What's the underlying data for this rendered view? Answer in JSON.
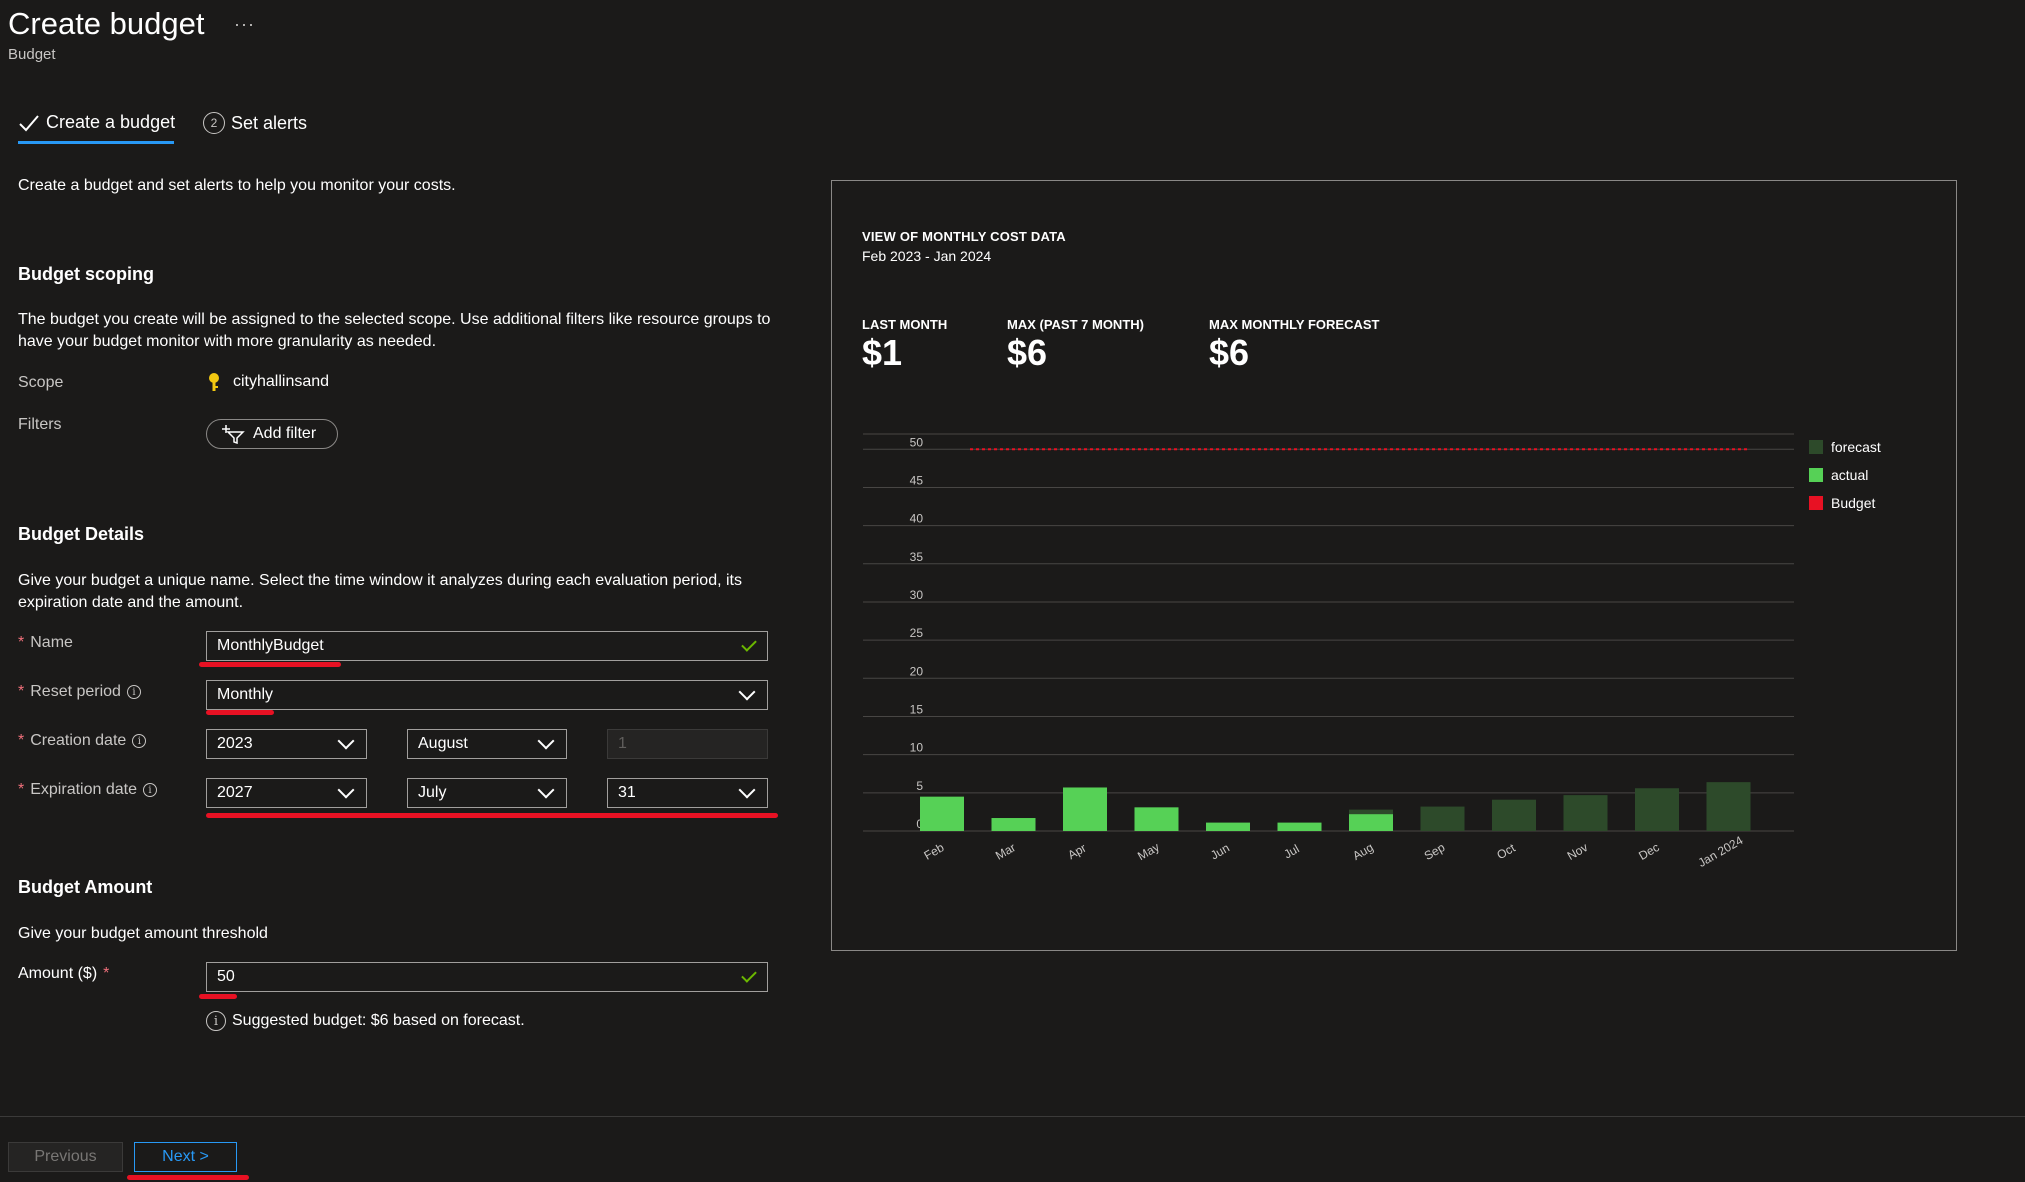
{
  "header": {
    "title": "Create budget",
    "more": "···",
    "subtitle": "Budget"
  },
  "tabs": [
    {
      "label": "Create a budget",
      "active": true
    },
    {
      "label": "Set alerts",
      "step": "2",
      "active": false
    }
  ],
  "intro": "Create a budget and set alerts to help you monitor your costs.",
  "scoping": {
    "heading": "Budget scoping",
    "description": "The budget you create will be assigned to the selected scope. Use additional filters like resource groups to have your budget monitor with more granularity as needed.",
    "scope_label": "Scope",
    "scope_value": "cityhallinsand",
    "filters_label": "Filters",
    "add_filter_label": "Add filter"
  },
  "details": {
    "heading": "Budget Details",
    "description": "Give your budget a unique name. Select the time window it analyzes during each evaluation period, its expiration date and the amount.",
    "required_mark": "*",
    "name_label": "Name",
    "name_value": "MonthlyBudget",
    "reset_label": "Reset period",
    "reset_value": "Monthly",
    "creation_label": "Creation date",
    "creation_year": "2023",
    "creation_month": "August",
    "creation_day": "1",
    "expiration_label": "Expiration date",
    "expiration_year": "2027",
    "expiration_month": "July",
    "expiration_day": "31"
  },
  "amount": {
    "heading": "Budget Amount",
    "description": "Give your budget amount threshold",
    "label": "Amount ($)",
    "value": "50",
    "suggestion": "Suggested budget: $6 based on forecast."
  },
  "footer": {
    "previous_label": "Previous",
    "next_label": "Next >"
  },
  "panel": {
    "title": "VIEW OF MONTHLY COST DATA",
    "range": "Feb 2023 - Jan 2024",
    "kpis": [
      {
        "label": "LAST MONTH",
        "value": "$1"
      },
      {
        "label": "MAX (PAST 7 MONTH)",
        "value": "$6"
      },
      {
        "label": "MAX MONTHLY FORECAST",
        "value": "$6"
      }
    ]
  },
  "colors": {
    "forecast": "#2d4a2a",
    "actual": "#56d156",
    "budget": "#e81123",
    "accent": "#2899f5"
  },
  "chart_data": {
    "type": "bar",
    "categories": [
      "Feb",
      "Mar",
      "Apr",
      "May",
      "Jun",
      "Jul",
      "Aug",
      "Sep",
      "Oct",
      "Nov",
      "Dec",
      "Jan 2024"
    ],
    "series": [
      {
        "name": "actual",
        "values": [
          4.5,
          1.7,
          5.7,
          3.1,
          1.1,
          1.1,
          2.2,
          0,
          0,
          0,
          0,
          0
        ]
      },
      {
        "name": "forecast",
        "values": [
          0,
          0,
          0,
          0,
          0,
          0,
          2.8,
          3.2,
          4.1,
          4.7,
          5.6,
          6.4
        ]
      }
    ],
    "budget": 50,
    "legend": [
      "forecast",
      "actual",
      "Budget"
    ],
    "yticks": [
      0,
      5,
      10,
      15,
      20,
      25,
      30,
      35,
      40,
      45,
      50
    ],
    "ylim": [
      0,
      52
    ],
    "grid": true,
    "legend_position": "right"
  }
}
